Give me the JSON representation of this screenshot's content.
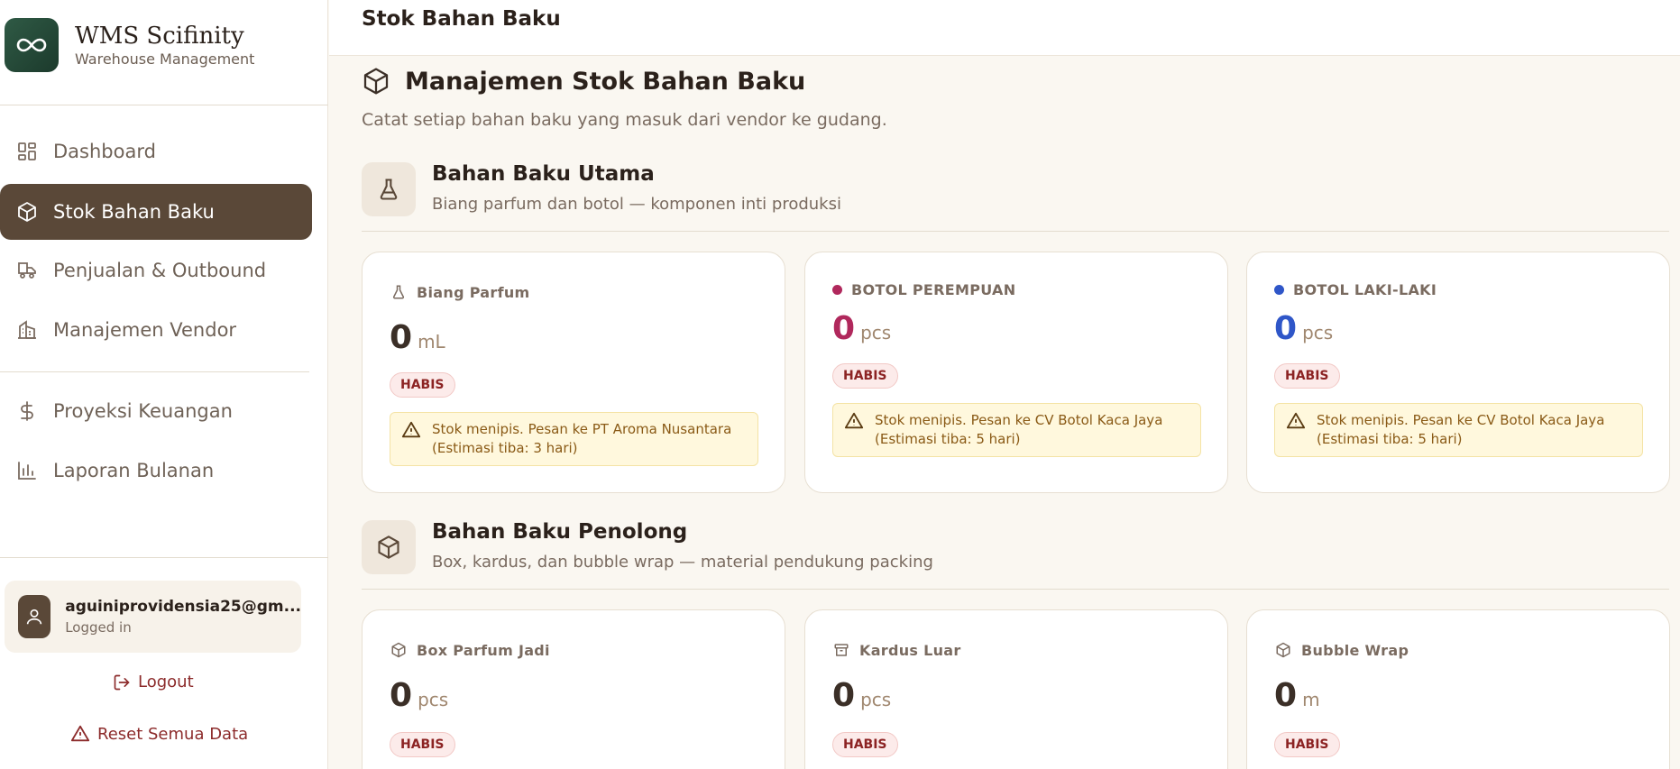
{
  "brand": {
    "title": "WMS Scifinity",
    "subtitle": "Warehouse Management"
  },
  "nav": [
    {
      "label": "Dashboard",
      "icon": "grid-icon",
      "active": false
    },
    {
      "label": "Stok Bahan Baku",
      "icon": "box-icon",
      "active": true
    },
    {
      "label": "Penjualan & Outbound",
      "icon": "truck-icon",
      "active": false
    },
    {
      "label": "Manajemen Vendor",
      "icon": "building-icon",
      "active": false
    },
    {
      "label": "Proyeksi Keuangan",
      "icon": "dollar-icon",
      "active": false
    },
    {
      "label": "Laporan Bulanan",
      "icon": "bar-chart-icon",
      "active": false
    }
  ],
  "user": {
    "email": "aguiniprovidensia25@gm...",
    "status": "Logged in"
  },
  "actions": {
    "logout": "Logout",
    "reset": "Reset Semua Data"
  },
  "topbar": {
    "title": "Stok Bahan Baku"
  },
  "page": {
    "title": "Manajemen Stok Bahan Baku",
    "subtitle": "Catat setiap bahan baku yang masuk dari vendor ke gudang."
  },
  "sections": [
    {
      "title": "Bahan Baku Utama",
      "subtitle": "Biang parfum dan botol — komponen inti produksi",
      "icon": "flask-icon",
      "cards": [
        {
          "label": "Biang Parfum",
          "icon": "flask-icon",
          "value": "0",
          "unit": "mL",
          "value_color": "#3b2f27",
          "badge": "HABIS",
          "warning": "Stok menipis. Pesan ke PT Aroma Nusantara (Estimasi tiba: 3 hari)"
        },
        {
          "label": "BOTOL PEREMPUAN",
          "dot_color": "#b0285c",
          "value": "0",
          "unit": "pcs",
          "value_color": "#b0285c",
          "badge": "HABIS",
          "warning": "Stok menipis. Pesan ke CV Botol Kaca Jaya (Estimasi tiba: 5 hari)"
        },
        {
          "label": "BOTOL LAKI-LAKI",
          "dot_color": "#2f56c8",
          "value": "0",
          "unit": "pcs",
          "value_color": "#2f56c8",
          "badge": "HABIS",
          "warning": "Stok menipis. Pesan ke CV Botol Kaca Jaya (Estimasi tiba: 5 hari)"
        }
      ]
    },
    {
      "title": "Bahan Baku Penolong",
      "subtitle": "Box, kardus, dan bubble wrap — material pendukung packing",
      "icon": "box-icon",
      "cards": [
        {
          "label": "Box Parfum Jadi",
          "icon": "box-icon",
          "value": "0",
          "unit": "pcs",
          "value_color": "#3b2f27",
          "badge": "HABIS"
        },
        {
          "label": "Kardus Luar",
          "icon": "archive-icon",
          "value": "0",
          "unit": "pcs",
          "value_color": "#3b2f27",
          "badge": "HABIS"
        },
        {
          "label": "Bubble Wrap",
          "icon": "box-icon",
          "value": "0",
          "unit": "m",
          "value_color": "#3b2f27",
          "badge": "HABIS"
        }
      ]
    }
  ]
}
